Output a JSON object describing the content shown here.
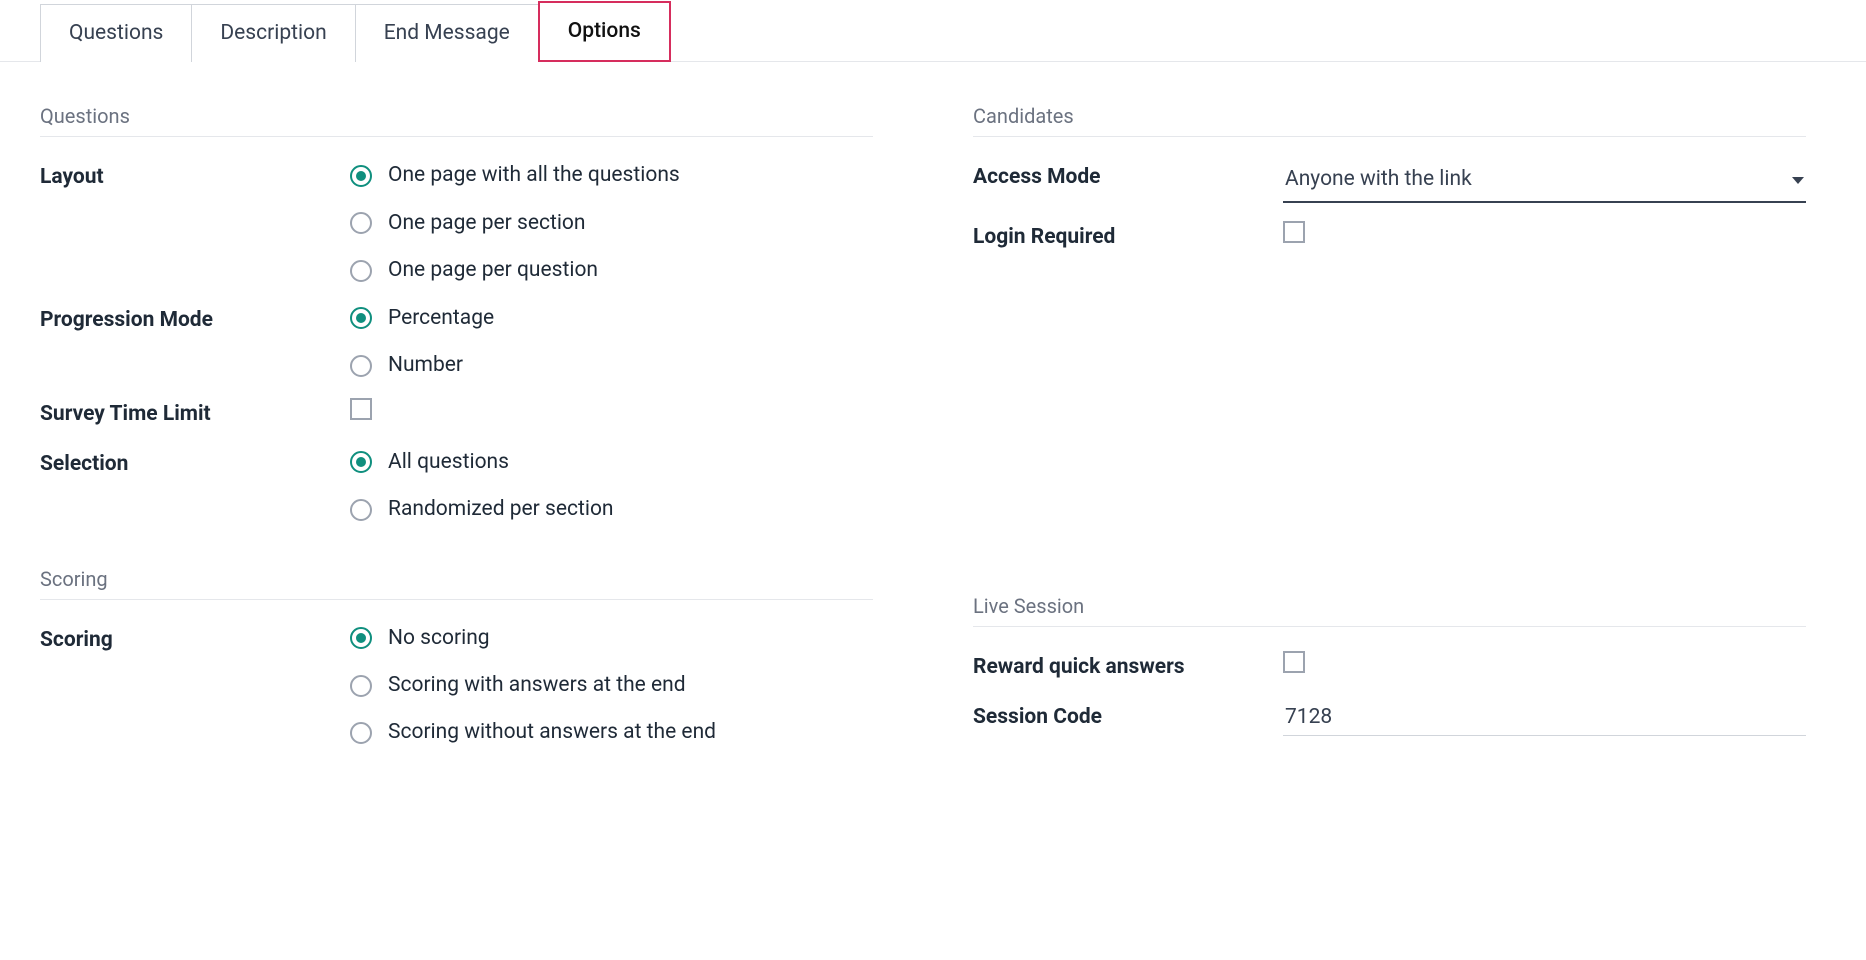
{
  "tabs": {
    "questions": "Questions",
    "description": "Description",
    "end_message": "End Message",
    "options": "Options",
    "active": "options"
  },
  "questions_section": {
    "title": "Questions",
    "layout": {
      "label": "Layout",
      "selected": 0,
      "options": [
        "One page with all the questions",
        "One page per section",
        "One page per question"
      ]
    },
    "progression_mode": {
      "label": "Progression Mode",
      "selected": 0,
      "options": [
        "Percentage",
        "Number"
      ]
    },
    "time_limit": {
      "label": "Survey Time Limit",
      "checked": false
    },
    "selection": {
      "label": "Selection",
      "selected": 0,
      "options": [
        "All questions",
        "Randomized per section"
      ]
    }
  },
  "scoring_section": {
    "title": "Scoring",
    "scoring": {
      "label": "Scoring",
      "selected": 0,
      "options": [
        "No scoring",
        "Scoring with answers at the end",
        "Scoring without answers at the end"
      ]
    }
  },
  "candidates_section": {
    "title": "Candidates",
    "access_mode": {
      "label": "Access Mode",
      "value": "Anyone with the link"
    },
    "login_required": {
      "label": "Login Required",
      "checked": false
    }
  },
  "live_session_section": {
    "title": "Live Session",
    "reward_quick": {
      "label": "Reward quick answers",
      "checked": false
    },
    "session_code": {
      "label": "Session Code",
      "value": "7128"
    }
  }
}
